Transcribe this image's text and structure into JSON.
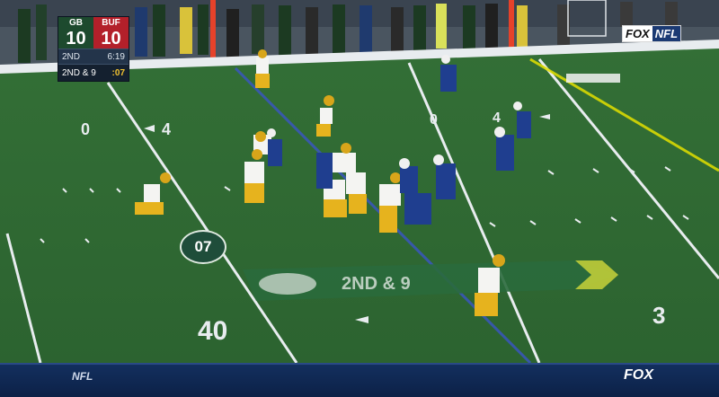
{
  "scorebug": {
    "home": {
      "abbr": "GB",
      "score": "10"
    },
    "away": {
      "abbr": "BUF",
      "score": "10"
    },
    "quarter": "2ND",
    "game_clock": "6:19",
    "down_distance": "2ND & 9",
    "play_clock": ":07"
  },
  "network_bug": {
    "left": "FOX",
    "right": "NFL"
  },
  "field": {
    "yard_numbers": [
      "0",
      "4",
      "0",
      "4",
      "40",
      "3"
    ],
    "down_marker_graphic": "2ND & 9",
    "sideline_banner": "NFL"
  },
  "overlay": {
    "play_clock_badge": "07"
  },
  "bottom_bar": {
    "left_logo": "NFL",
    "right_logo": "FOX"
  },
  "colors": {
    "turf": "#2f6b32",
    "packers_green": "#1d4a2e",
    "packers_gold": "#e6b31e",
    "bills_blue": "#1f3e8f",
    "first_down_line": "#e3e000",
    "line_of_scrimmage": "#3a55c8"
  }
}
